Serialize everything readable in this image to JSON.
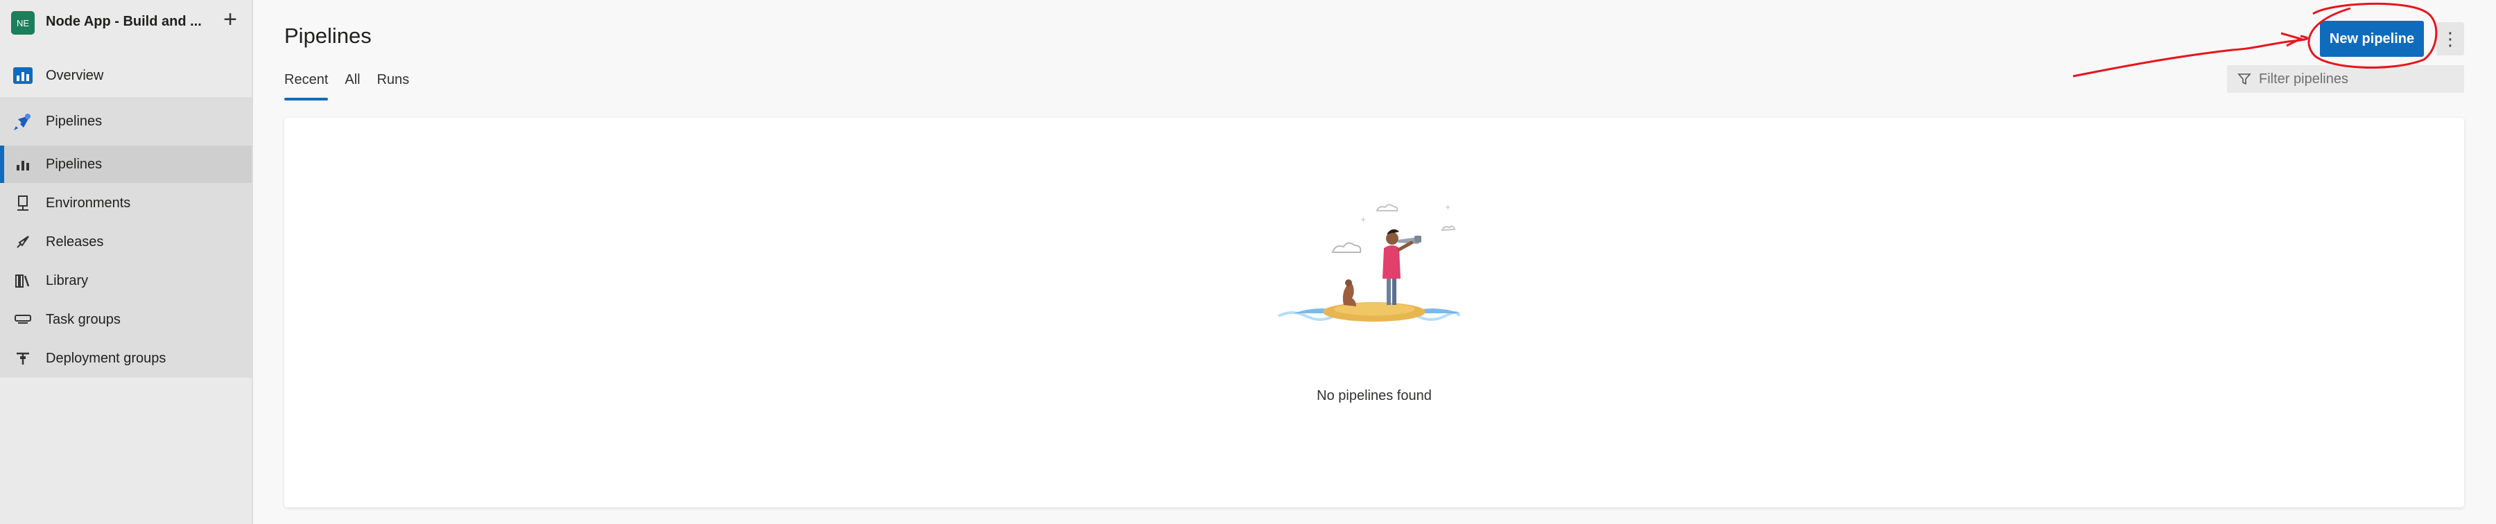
{
  "project": {
    "badge": "NE",
    "name": "Node App - Build and ...",
    "add_icon": "plus-icon"
  },
  "sidebar": {
    "overview": {
      "label": "Overview",
      "icon": "overview-icon"
    },
    "pipelines_group": {
      "label": "Pipelines",
      "icon": "pipelines-rocket-icon"
    },
    "items": [
      {
        "label": "Pipelines",
        "icon": "pipeline-icon",
        "selected": true
      },
      {
        "label": "Environments",
        "icon": "environments-icon"
      },
      {
        "label": "Releases",
        "icon": "releases-rocket-icon"
      },
      {
        "label": "Library",
        "icon": "library-icon"
      },
      {
        "label": "Task groups",
        "icon": "task-groups-icon"
      },
      {
        "label": "Deployment groups",
        "icon": "deployment-groups-icon"
      }
    ]
  },
  "main": {
    "title": "Pipelines",
    "tabs": [
      {
        "label": "Recent",
        "active": true
      },
      {
        "label": "All"
      },
      {
        "label": "Runs"
      }
    ],
    "new_pipeline_label": "New pipeline",
    "more_icon": "more-vertical-icon",
    "filter": {
      "placeholder": "Filter pipelines",
      "value": "",
      "icon": "filter-icon"
    },
    "empty_state": {
      "text": "No pipelines found",
      "illustration": "island-explorer-illustration"
    }
  },
  "colors": {
    "accent": "#0f6cbd",
    "annotation": "#e8151d",
    "project_badge": "#1a7f5a"
  }
}
